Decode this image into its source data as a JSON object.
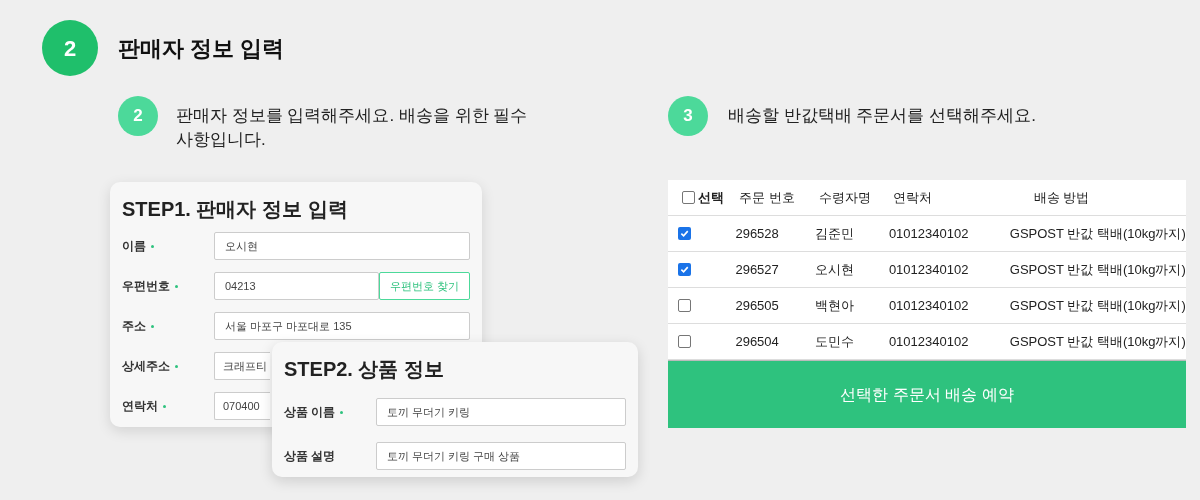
{
  "section": {
    "number": "2",
    "title": "판매자 정보 입력"
  },
  "left": {
    "step": {
      "number": "2",
      "text": "판매자 정보를 입력해주세요. 배송을 위한 필수 사항입니다."
    },
    "seller_card": {
      "title": "STEP1. 판매자 정보 입력",
      "fields": [
        {
          "label": "이름",
          "required": true,
          "value": "오시현"
        },
        {
          "label": "우편번호",
          "required": true,
          "value": "04213",
          "button": "우편번호 찾기"
        },
        {
          "label": "주소",
          "required": true,
          "value": "서울 마포구 마포대로 135"
        },
        {
          "label": "상세주소",
          "required": true,
          "value": "크래프티",
          "kind": "partial"
        },
        {
          "label": "연락처",
          "required": true,
          "value": "070400",
          "kind": "partial"
        }
      ]
    },
    "product_card": {
      "title": "STEP2. 상품 정보",
      "fields": [
        {
          "label": "상품 이름",
          "required": true,
          "value": "토끼 무더기 키링"
        },
        {
          "label": "상품 설명",
          "required": false,
          "value": "토끼 무더기 키링 구매 상품"
        }
      ]
    }
  },
  "right": {
    "step": {
      "number": "3",
      "text": "배송할 반값택배 주문서를 선택해주세요."
    },
    "table": {
      "select_all": {
        "label": "선택",
        "checked": false
      },
      "columns": [
        "주문 번호",
        "수령자명",
        "연락처",
        "배송 방법"
      ],
      "rows": [
        {
          "checked": true,
          "cells": [
            "296528",
            "김준민",
            "01012340102",
            "GSPOST 반값 택배(10kg까지)"
          ]
        },
        {
          "checked": true,
          "cells": [
            "296527",
            "오시현",
            "01012340102",
            "GSPOST 반값 택배(10kg까지)"
          ]
        },
        {
          "checked": false,
          "cells": [
            "296505",
            "백현아",
            "01012340102",
            "GSPOST 반값 택배(10kg까지)"
          ]
        },
        {
          "checked": false,
          "cells": [
            "296504",
            "도민수",
            "01012340102",
            "GSPOST 반값 택배(10kg까지)"
          ]
        }
      ]
    },
    "submit": "선택한 주문서 배송 예약"
  }
}
